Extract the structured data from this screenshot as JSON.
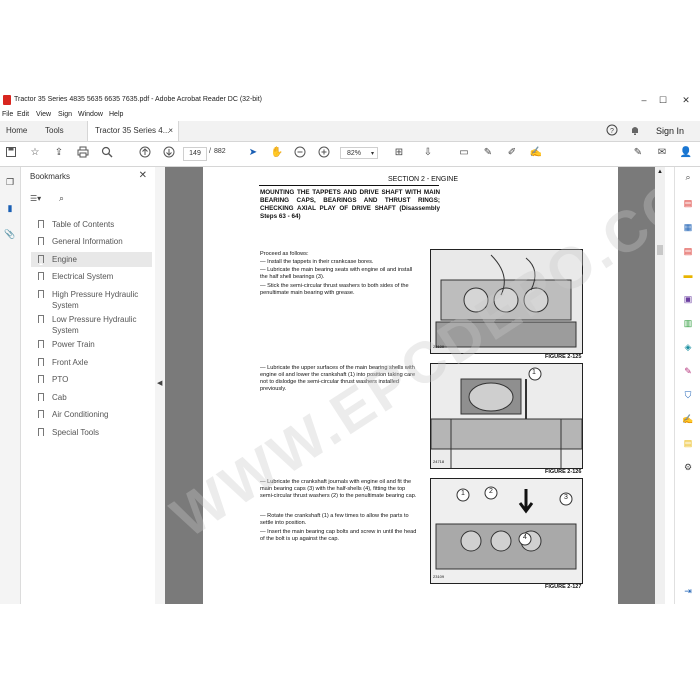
{
  "window": {
    "title": "Tractor 35 Series 4835 5635 6635 7635.pdf - Adobe Acrobat Reader DC (32-bit)",
    "controls": [
      "–",
      "☐",
      "✕"
    ]
  },
  "menu": [
    "File",
    "Edit",
    "View",
    "Sign",
    "Window",
    "Help"
  ],
  "tabs": {
    "home": "Home",
    "tools": "Tools",
    "document": "Tractor 35 Series 4...",
    "close": "×",
    "sign_in": "Sign In"
  },
  "toolbar": {
    "page_current": "149",
    "page_separator": "/",
    "page_total": "882",
    "zoom": "82%"
  },
  "bookmarks": {
    "title": "Bookmarks",
    "items": [
      {
        "label": "Table of Contents"
      },
      {
        "label": "General Information"
      },
      {
        "label": "Engine",
        "selected": true
      },
      {
        "label": "Electrical System"
      },
      {
        "label": "High Pressure Hydraulic System"
      },
      {
        "label": "Low Pressure Hydraulic System"
      },
      {
        "label": "Power Train"
      },
      {
        "label": "Front Axle"
      },
      {
        "label": "PTO"
      },
      {
        "label": "Cab"
      },
      {
        "label": "Air Conditioning"
      },
      {
        "label": "Special Tools"
      }
    ]
  },
  "document": {
    "section": "SECTION 2 - ENGINE",
    "heading": "MOUNTING THE TAPPETS AND DRIVE SHAFT WITH MAIN BEARING CAPS, BEARINGS AND THRUST RINGS; CHECKING AXIAL PLAY OF DRIVE SHAFT (Disassembly Steps 63 - 64)",
    "proceed": "Proceed as follows:",
    "step1": "— Install the tappets in their crankcase bores.",
    "step2": "— Lubricate the main bearing seats with engine oil and install the half shell bearings (3).",
    "step3": "— Stick the semi-circular thrust washers to both sides of the penultimate main bearing with grease.",
    "step4": "— Lubricate the upper surfaces of the main bearing shells with engine oil and lower the crankshaft (1) into position taking care not to dislodge the semi-circular thrust washers installed previously.",
    "step5": "— Lubricate the crankshaft journals with engine oil and fit the main bearing caps (3) with the half-shells (4), fitting the top semi-circular thrust washers (2) to the penultimate bearing cap.",
    "step6": "— Rotate the crankshaft (1) a few times to allow the parts to settle into position.",
    "step7": "— Insert the main bearing cap bolts and screw in until the head of the bolt is up against the cap.",
    "fig1_caption": "FIGURE 2-125",
    "fig2_caption": "FIGURE 2-126",
    "fig3_caption": "FIGURE 2-127",
    "fig1_code": "23109",
    "fig2_code": "24718",
    "fig3_code": "23109",
    "fig2_callout": "1",
    "fig3_callouts": [
      "1",
      "2",
      "3",
      "4"
    ],
    "watermark": "WWW.EPCDEPO.COM"
  },
  "colors": {
    "acrobat_red": "#d8261f",
    "doc_background": "#7a7a7a"
  }
}
